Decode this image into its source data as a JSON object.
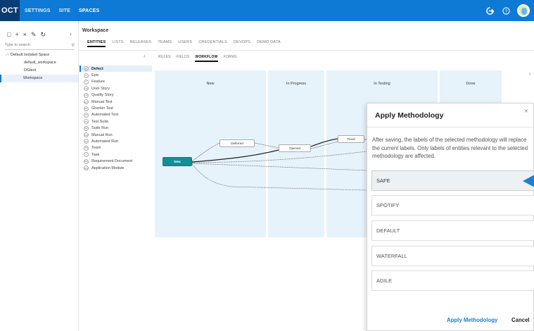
{
  "topbar": {
    "brand": "OCT",
    "nav": [
      "SETTINGS",
      "SITE",
      "SPACES"
    ],
    "active_nav": "SPACES"
  },
  "left_panel": {
    "search_placeholder": "Type to search",
    "tree": [
      {
        "label": "Default Isolated Space",
        "level": 0
      },
      {
        "label": "default_workspace",
        "level": 1
      },
      {
        "label": "DGtest",
        "level": 1
      },
      {
        "label": "Workspace",
        "level": 1,
        "selected": true
      }
    ]
  },
  "workspace": {
    "title": "Workspace",
    "tabs": [
      "ENTITIES",
      "LISTS",
      "RELEASES",
      "TEAMS",
      "USERS",
      "CREDENTIALS",
      "DEVOPS",
      "DEMO DATA"
    ],
    "active_tab": "ENTITIES"
  },
  "entities": [
    {
      "label": "Defect",
      "icon": "D",
      "selected": true
    },
    {
      "label": "Epic",
      "icon": "E"
    },
    {
      "label": "Feature",
      "icon": "F"
    },
    {
      "label": "User Story",
      "icon": "US"
    },
    {
      "label": "Quality Story",
      "icon": "QS"
    },
    {
      "label": "Manual Test",
      "icon": "MT"
    },
    {
      "label": "Gherkin Test",
      "icon": "GT"
    },
    {
      "label": "Automated Test",
      "icon": "AT"
    },
    {
      "label": "Test Suite",
      "icon": "TS"
    },
    {
      "label": "Suite Run",
      "icon": "SR"
    },
    {
      "label": "Manual Run",
      "icon": "MR"
    },
    {
      "label": "Automated Run",
      "icon": "AR"
    },
    {
      "label": "Team",
      "icon": "TM"
    },
    {
      "label": "Task",
      "icon": "T"
    },
    {
      "label": "Requirement Document",
      "icon": "RD"
    },
    {
      "label": "Application Module",
      "icon": "AM"
    }
  ],
  "entity_tabs": [
    "RULES",
    "FIELDS",
    "WORKFLOW",
    "FORMS"
  ],
  "active_entity_tab": "WORKFLOW",
  "workflow": {
    "lanes": [
      "New",
      "In Progress",
      "In Testing",
      "Done"
    ],
    "nodes": [
      "New",
      "Deferred",
      "Opened",
      "Fixed"
    ]
  },
  "dialog": {
    "title": "Apply Methodology",
    "description": "After saving, the labels of the selected methodology will replace the current labels. Only labels of entities relevant to the selected methodology are affected.",
    "options": [
      "SAFE",
      "SPOTIFY",
      "DEFAULT",
      "WATERFALL",
      "AGILE"
    ],
    "selected_option": "SAFE",
    "apply_label": "Apply Methodology",
    "cancel_label": "Cancel"
  },
  "colors": {
    "topbar": "#0f7ad6",
    "brand_bg": "#0a3c73",
    "accent": "#1a7fd6",
    "new_node": "#138f96",
    "lane": "#e6f3fb"
  }
}
